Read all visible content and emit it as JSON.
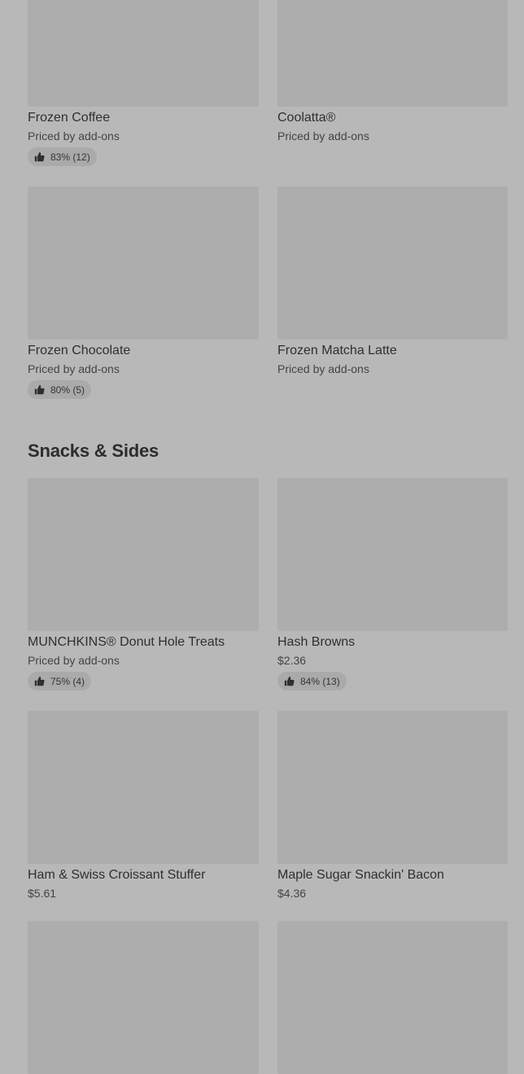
{
  "colors": {
    "background": "#b8b8b8",
    "thumbnail": "#adadad",
    "rating_pill": "#aaaaaa",
    "text": "#2e2e2e"
  },
  "top_items": [
    {
      "name": "Frozen Coffee",
      "price": "Priced by add-ons",
      "rating": "83% (12)",
      "icon": "thumbs-up-icon"
    },
    {
      "name": "Coolatta®",
      "price": "Priced by add-ons",
      "rating": null
    },
    {
      "name": "Frozen Chocolate",
      "price": "Priced by add-ons",
      "rating": "80% (5)",
      "icon": "thumbs-up-icon"
    },
    {
      "name": "Frozen Matcha Latte",
      "price": "Priced by add-ons",
      "rating": null
    }
  ],
  "snacks_section": {
    "title": "Snacks & Sides",
    "items": [
      {
        "name": "MUNCHKINS® Donut Hole Treats",
        "price": "Priced by add-ons",
        "rating": "75% (4)",
        "icon": "thumbs-up-icon"
      },
      {
        "name": "Hash Browns",
        "price": "$2.36",
        "rating": "84% (13)",
        "icon": "thumbs-up-icon"
      },
      {
        "name": "Ham & Swiss Croissant Stuffer",
        "price": "$5.61",
        "rating": null
      },
      {
        "name": "Maple Sugar Snackin' Bacon",
        "price": "$4.36",
        "rating": null
      }
    ]
  }
}
